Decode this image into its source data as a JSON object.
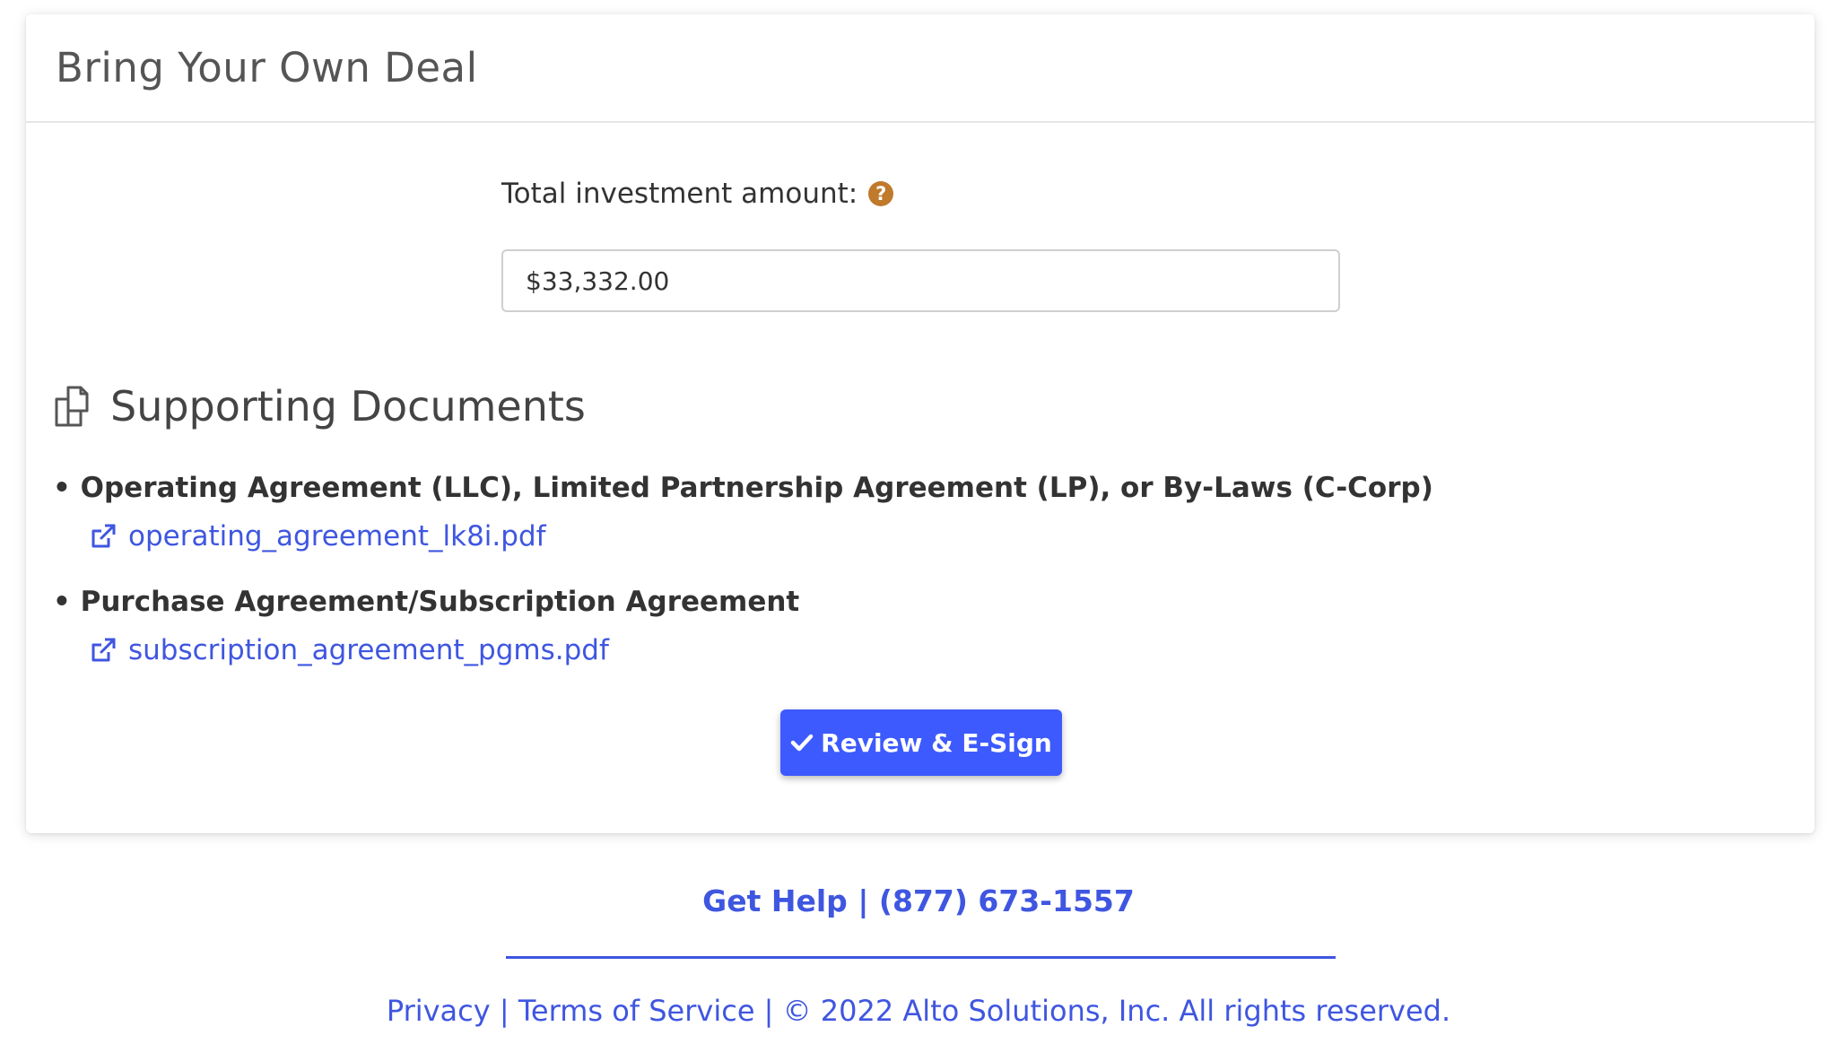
{
  "card": {
    "title": "Bring Your Own Deal"
  },
  "investment": {
    "label": "Total investment amount:",
    "help_icon": "question-circle-icon",
    "value": "$33,332.00"
  },
  "documents": {
    "heading": "Supporting Documents",
    "heading_icon": "copy-documents-icon",
    "items": [
      {
        "bullet": "•",
        "title": "Operating Agreement (LLC), Limited Partnership Agreement (LP), or By-Laws (C-Corp)",
        "link_icon": "external-link-icon",
        "file": "operating_agreement_lk8i.pdf"
      },
      {
        "bullet": "•",
        "title": "Purchase Agreement/Subscription Agreement",
        "link_icon": "external-link-icon",
        "file": "subscription_agreement_pgms.pdf"
      }
    ]
  },
  "action": {
    "icon": "checkmark-icon",
    "label": "Review & E-Sign"
  },
  "help": {
    "label": "Get Help",
    "separator": "|",
    "phone": "(877) 673-1557"
  },
  "footer": {
    "privacy": "Privacy",
    "sep1": "|",
    "terms": "Terms of Service",
    "sep2": "|",
    "copyright": "© 2022 Alto Solutions, Inc. All rights reserved."
  },
  "colors": {
    "accent": "#3d5afe",
    "link": "#3f56e0",
    "help_icon": "#c07a2c"
  }
}
